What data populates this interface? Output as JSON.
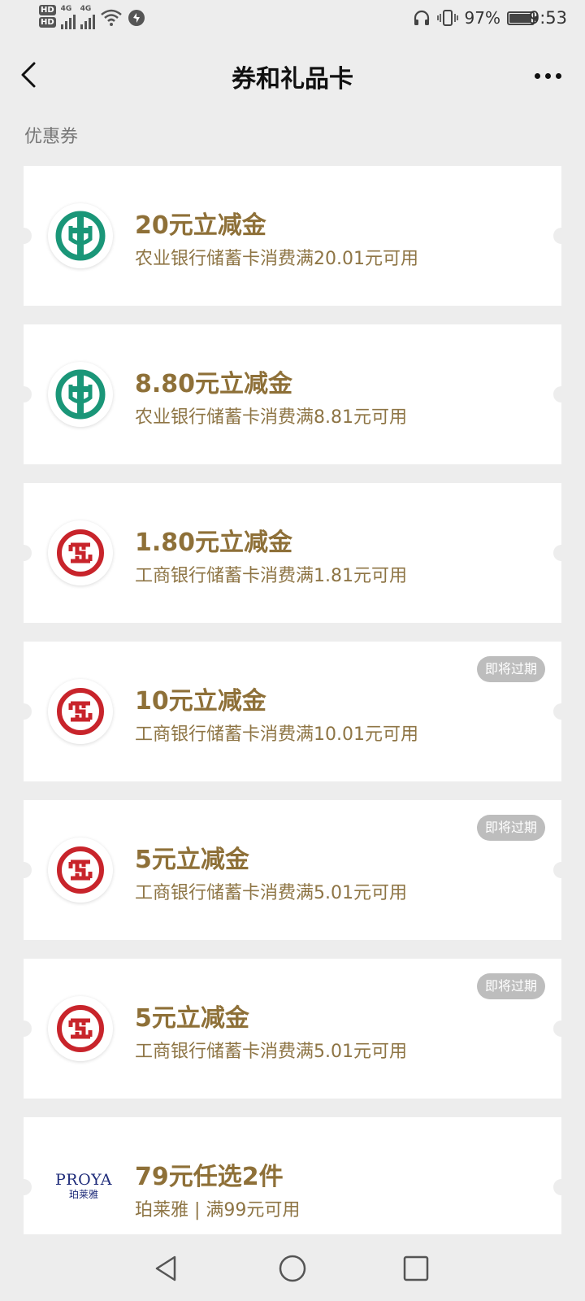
{
  "status_bar": {
    "hd1": "HD",
    "hd2": "HD",
    "net1": "4G",
    "net2": "4G",
    "battery_percent": "97%",
    "battery_level": 0.97,
    "time": "9:53"
  },
  "header": {
    "title": "券和礼品卡"
  },
  "section_label": "优惠券",
  "coupons": [
    {
      "title": "20元立减金",
      "subtitle": "农业银行储蓄卡消费满20.01元可用",
      "bank": "abc",
      "badge": ""
    },
    {
      "title": "8.80元立减金",
      "subtitle": "农业银行储蓄卡消费满8.81元可用",
      "bank": "abc",
      "badge": ""
    },
    {
      "title": "1.80元立减金",
      "subtitle": "工商银行储蓄卡消费满1.81元可用",
      "bank": "icbc",
      "badge": ""
    },
    {
      "title": "10元立减金",
      "subtitle": "工商银行储蓄卡消费满10.01元可用",
      "bank": "icbc",
      "badge": "即将过期"
    },
    {
      "title": "5元立减金",
      "subtitle": "工商银行储蓄卡消费满5.01元可用",
      "bank": "icbc",
      "badge": "即将过期"
    },
    {
      "title": "5元立减金",
      "subtitle": "工商银行储蓄卡消费满5.01元可用",
      "bank": "icbc",
      "badge": "即将过期"
    },
    {
      "title": "79元任选2件",
      "subtitle": "珀莱雅 | 满99元可用",
      "bank": "proya",
      "badge": "",
      "logo_text_en": "PROYA",
      "logo_text_cn": "珀莱雅"
    }
  ],
  "colors": {
    "abc_green": "#1a9678",
    "icbc_red": "#c8242b",
    "coupon_text": "#8e7038",
    "badge_bg": "#bdbdbd"
  }
}
